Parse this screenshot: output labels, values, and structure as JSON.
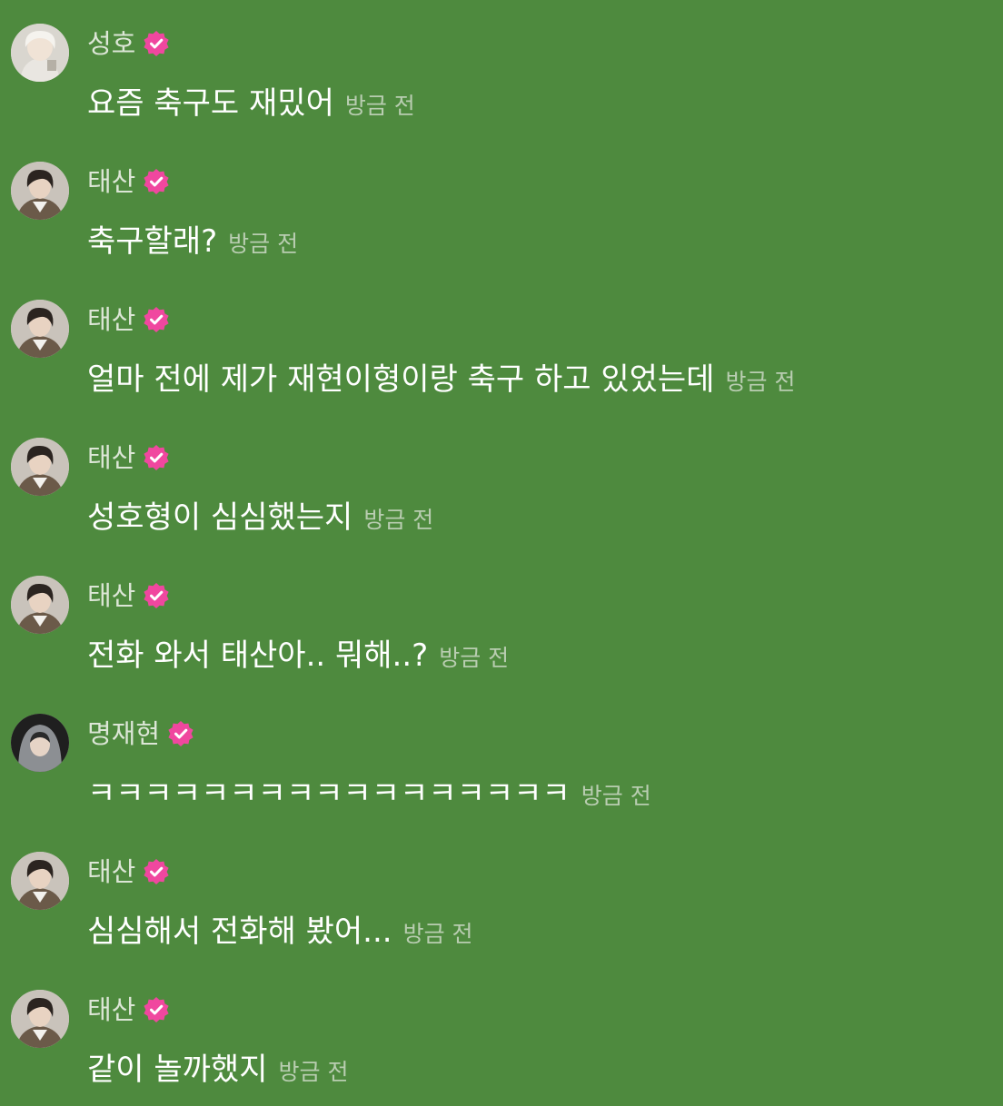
{
  "colors": {
    "background": "#4e8a3e",
    "verified_badge": "#f0479f",
    "text": "#ffffff",
    "meta": "#b9cdb1"
  },
  "messages": [
    {
      "sender": "성호",
      "avatar": "avatar-light-hair",
      "verified": true,
      "text": "요즘 축구도 재밌어",
      "time": "방금 전"
    },
    {
      "sender": "태산",
      "avatar": "avatar-dark-hair",
      "verified": true,
      "text": "축구할래?",
      "time": "방금 전"
    },
    {
      "sender": "태산",
      "avatar": "avatar-dark-hair",
      "verified": true,
      "text": "얼마 전에 제가 재현이형이랑 축구 하고 있었는데",
      "time": "방금 전"
    },
    {
      "sender": "태산",
      "avatar": "avatar-dark-hair",
      "verified": true,
      "text": "성호형이 심심했는지",
      "time": "방금 전"
    },
    {
      "sender": "태산",
      "avatar": "avatar-dark-hair",
      "verified": true,
      "text": "전화 와서 태산아.. 뭐해..?",
      "time": "방금 전"
    },
    {
      "sender": "명재현",
      "avatar": "avatar-hood",
      "verified": true,
      "text": "ㅋㅋㅋㅋㅋㅋㅋㅋㅋㅋㅋㅋㅋㅋㅋㅋㅋ",
      "time": "방금 전"
    },
    {
      "sender": "태산",
      "avatar": "avatar-dark-hair",
      "verified": true,
      "text": "심심해서 전화해 봤어...",
      "time": "방금 전"
    },
    {
      "sender": "태산",
      "avatar": "avatar-dark-hair",
      "verified": true,
      "text": "같이 놀까했지",
      "time": "방금 전"
    }
  ]
}
